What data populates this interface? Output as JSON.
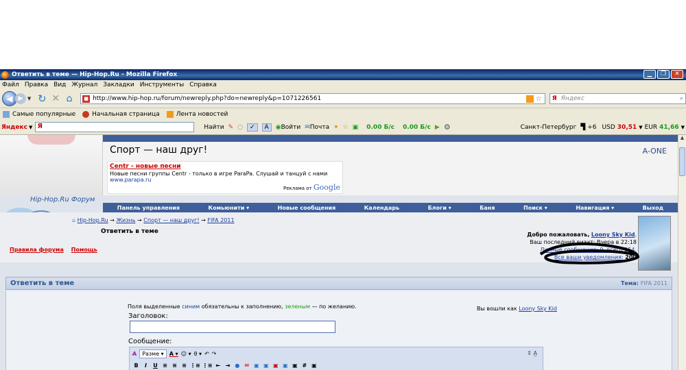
{
  "window": {
    "title": "Ответить в теме — Hip-Hop.Ru - Mozilla Firefox"
  },
  "menu": [
    "Файл",
    "Правка",
    "Вид",
    "Журнал",
    "Закладки",
    "Инструменты",
    "Справка"
  ],
  "nav": {
    "url": "http://www.hip-hop.ru/forum/newreply.php?do=newreply&p=1071226561",
    "search_engine": "Я",
    "search_placeholder": "Яндекс"
  },
  "bookmarks": [
    "Самые популярные",
    "Начальная страница",
    "Лента новостей"
  ],
  "yabar": {
    "logo": "Яндекс",
    "field_text": "Я",
    "find": "Найти",
    "login": "Войти",
    "mail": "Почта",
    "speed1": "0.00 Б/с",
    "speed2": "0.00 Б/с",
    "city": "Санкт-Петербург",
    "temp": "+6",
    "usd_label": "USD",
    "usd_value": "30,51",
    "eur_label": "EUR",
    "eur_value": "41,66"
  },
  "forum": {
    "section_title": "Спорт — наш друг!",
    "a_one": "A-ONE",
    "ad": {
      "title": "Centr - новые песни",
      "desc": "Новые песни группы Centr - только в игре ParaPa. Слушай и танцуй с нами",
      "url": "www.parapa.ru",
      "google_prefix": "Реклама от",
      "google": "Google"
    },
    "forum_name": "Hip-Hop.Ru Форум",
    "navlinks": [
      "Панель управления",
      "Комьюнити",
      "Новые сообщения",
      "Календарь",
      "Блоги",
      "Баня",
      "Поиск",
      "Навигация",
      "Выход"
    ],
    "breadcrumb": [
      "Hip-Hop.Ru",
      "Жизнь",
      "Спорт — наш друг!",
      "FIFA 2011"
    ],
    "reply_title": "Ответить в теме",
    "rules_links": [
      "Правила форума",
      "Помощь"
    ],
    "welcome_prefix": "Добро пожаловать,",
    "username": "Loony Sky Kid",
    "last_visit": "Ваш последний визит: Вчера в 22:18",
    "personal": "Личные сообщения: 0, всего 254.",
    "notif_label": "Все ваши уведомления:",
    "notif_count": "200"
  },
  "form": {
    "header": "Ответить в теме",
    "topic_label": "Тема:",
    "topic_value": "FIFA 2011",
    "hint_pre": "Поля выделенные",
    "hint_blue": "синим",
    "hint_mid": "обязательны к заполнению,",
    "hint_green": "зеленым",
    "hint_post": "— по желанию.",
    "logged_pre": "Вы вошли как",
    "logged_user": "Loony Sky Kid",
    "title_label": "Заголовок:",
    "title_value": "",
    "message_label": "Сообщение:",
    "size_select": "Разме",
    "toolbar2": [
      "B",
      "I",
      "U",
      "≡",
      "≡",
      "≡",
      "⋮≡",
      "⋮≡",
      "⇤",
      "⇥",
      "●",
      "✉",
      "▣",
      "▣",
      "▣",
      "▣",
      "▣",
      "#",
      "▣"
    ]
  },
  "colors": {
    "nav_strip": "#3e5f99",
    "titlebar": "#0a246a",
    "link": "#1a3d9e",
    "ad_title": "#c00000"
  }
}
